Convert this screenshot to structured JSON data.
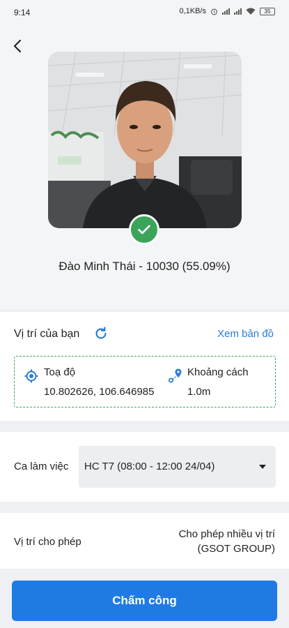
{
  "status_bar": {
    "time": "9:14",
    "net_speed": "0,1KB/s",
    "battery": "35"
  },
  "profile": {
    "name_line": "Đào Minh Thái - 10030 (55.09%)",
    "verified_color": "#3aa45a"
  },
  "location": {
    "title": "Vị trí của bạn",
    "map_link": "Xem bản đồ",
    "coord_label": "Toạ độ",
    "coord_value": "10.802626, 106.646985",
    "distance_label": "Khoảng cách",
    "distance_value": "1.0m"
  },
  "shift": {
    "label": "Ca làm việc",
    "selected": "HC T7 (08:00 - 12:00 24/04)"
  },
  "allowed": {
    "label": "Vị trí cho phép",
    "value_line1": "Cho phép nhiều vị trí",
    "value_line2": "(GSOT GROUP)"
  },
  "actions": {
    "submit_label": "Chấm công"
  },
  "colors": {
    "accent": "#1f7be3",
    "link": "#2a7bd6",
    "success": "#3aa45a"
  }
}
